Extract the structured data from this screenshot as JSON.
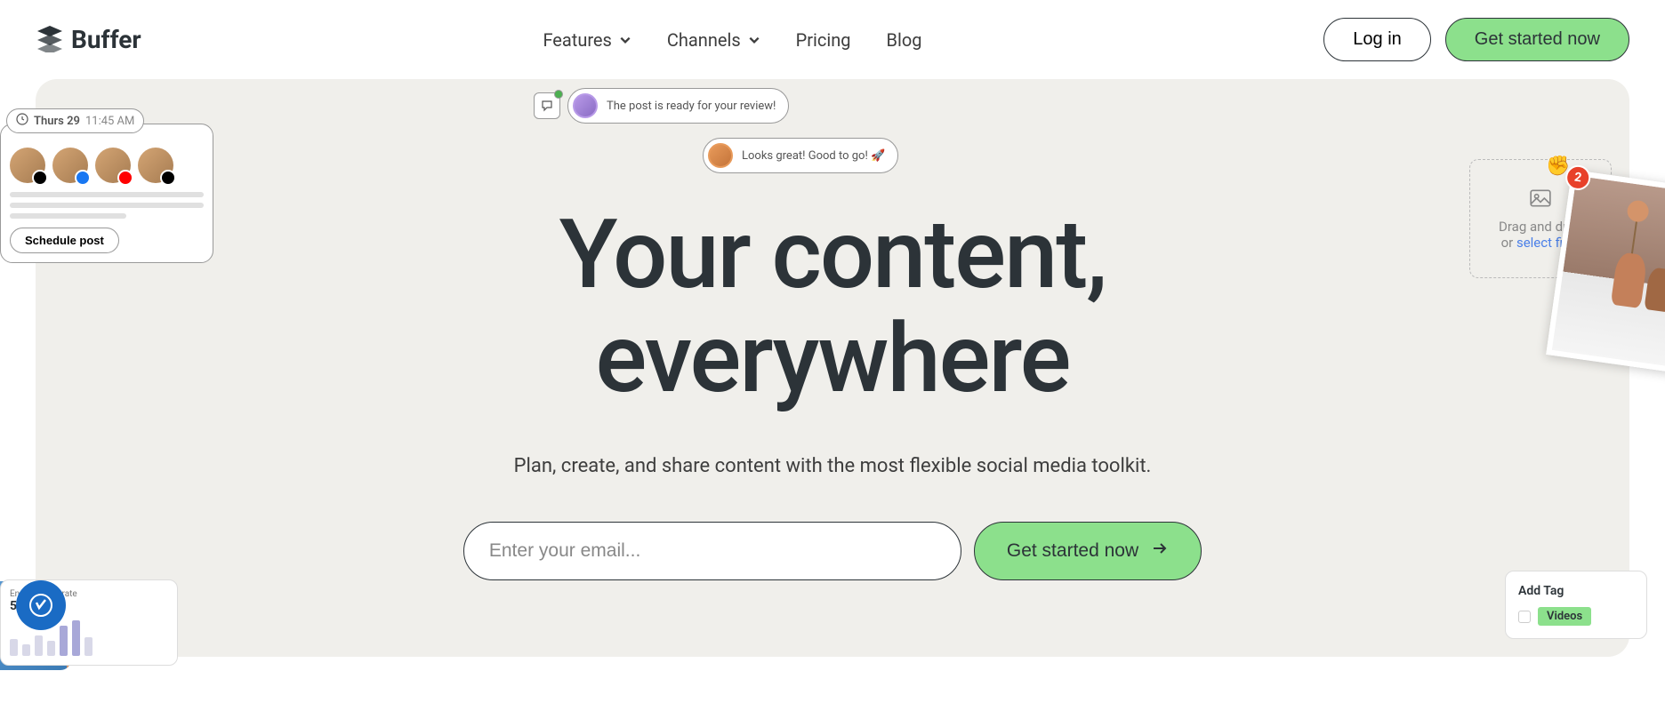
{
  "brand": {
    "name": "Buffer"
  },
  "nav": {
    "features": "Features",
    "channels": "Channels",
    "pricing": "Pricing",
    "blog": "Blog"
  },
  "header": {
    "login": "Log in",
    "cta": "Get started now"
  },
  "hero": {
    "headline_line1": "Your content,",
    "headline_line2": "everywhere",
    "subheadline": "Plan, create, and share content with the most flexible social media toolkit.",
    "email_placeholder": "Enter your email...",
    "signup_cta": "Get started now"
  },
  "scheduler": {
    "day": "Thurs 29",
    "time": "11:45 AM",
    "button": "Schedule post"
  },
  "comments": {
    "review": "The post is ready for your review!",
    "approve": "Looks great! Good to go! 🚀"
  },
  "dropzone": {
    "text_line1": "Drag and drop",
    "text_line2_prefix": "or ",
    "text_line2_link": "select files"
  },
  "photo": {
    "badge_count": "2"
  },
  "chart": {
    "label": "Engagement rate",
    "value": "5.0%"
  },
  "tag_panel": {
    "title": "Add Tag",
    "tag1": "Videos"
  },
  "colors": {
    "accent_green": "#8ce08c",
    "text_dark": "#2c3338",
    "bg_cream": "#f0efeb"
  }
}
